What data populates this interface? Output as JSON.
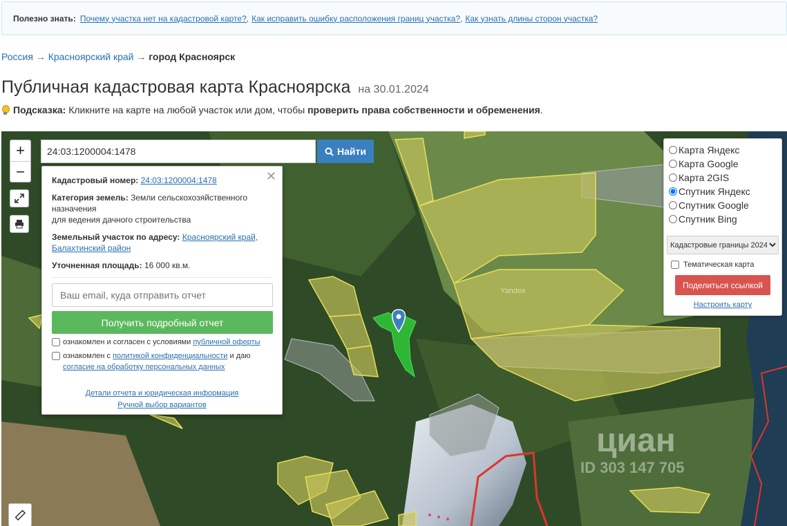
{
  "info_bar": {
    "label": "Полезно знать:",
    "links": [
      "Почему участка нет на кадастровой карте?,",
      "Как исправить ошибку расположения границ участка?,",
      "Как узнать длины сторон участка?"
    ]
  },
  "breadcrumb": {
    "items": [
      "Россия",
      "Красноярский край",
      "город Красноярск"
    ],
    "separator": "→"
  },
  "page": {
    "title": "Публичная кадастровая карта Красноярска",
    "date": "на 30.01.2024"
  },
  "hint": {
    "label": "Подсказка:",
    "text": "Кликните на карте на любой участок или дом, чтобы",
    "emphasis": "проверить права собственности и обременения",
    "end": "."
  },
  "map": {
    "zoom_in": "+",
    "zoom_out": "−",
    "search_value": "24:03:1200004:1478",
    "find_label": "Найти",
    "provider_watermark": "Yandex",
    "watermark_brand": "циан",
    "watermark_id": "ID 303 147 705"
  },
  "popup": {
    "cadastral_label": "Кадастровый номер:",
    "cadastral_value": "24:03:1200004:1478",
    "category_label": "Категория земель:",
    "category_value": "Земли сельскохозяйственного назначения",
    "usage_value": "для ведения дачного строительства",
    "address_label": "Земельный участок по адресу:",
    "address_value": "Красноярский край, Балахтинский район",
    "area_label": "Уточненная площадь:",
    "area_value": "16 000 кв.м.",
    "email_placeholder": "Ваш email, куда отправить отчет",
    "report_button": "Получить подробный отчет",
    "consent1_text": "ознакомлен и согласен с условиями",
    "consent1_link": "публичной оферты",
    "consent2_text1": "ознакомлен с",
    "consent2_link1": "политикой конфиденциальности",
    "consent2_text2": "и даю",
    "consent2_link2": "согласие на обработку персональных данных",
    "details_link": "Детали отчета и юридическая информация",
    "manual_link": "Ручной выбор вариантов"
  },
  "layers": {
    "options": [
      "Карта Яндекс",
      "Карта Google",
      "Карта 2GIS",
      "Спутник Яндекс",
      "Спутник Google",
      "Спутник Bing"
    ],
    "selected": "Спутник Яндекс",
    "boundary_select": "Кадастровые границы 2024",
    "thematic_label": "Тематическая карта",
    "share_button": "Поделиться ссылкой",
    "configure_link": "Настроить карту"
  },
  "colors": {
    "parcel_fill": "#c9c45a",
    "parcel_stroke": "#e6df5a",
    "selected_parcel": "#2fc93b",
    "find_button": "#3a7fc0",
    "report_button": "#5cb85c",
    "share_button": "#d9534f",
    "border_line": "#e0352b"
  }
}
